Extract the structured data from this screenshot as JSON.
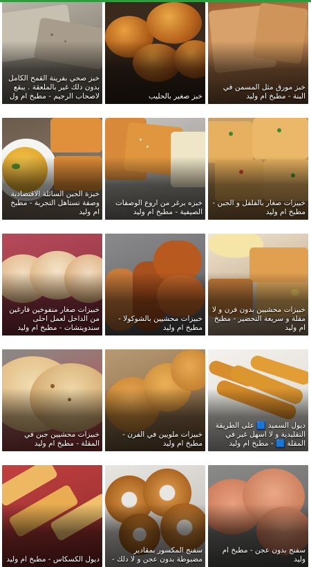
{
  "accent_color": "#2e9d3e",
  "recipes": [
    {
      "title": "خبز صحي بفرينة القمح الكامل بدون دلك غير بالملعقة . يبقع لاصحاب الرجيم - مطبخ ام ول"
    },
    {
      "title": "خبز صغير بالحليب"
    },
    {
      "title": "خبز مورق مثل المسمن في البنة - مطبخ ام وليد"
    },
    {
      "title": "خبزة الجبن السائلة الاقتصادية وصفة تستاهل التجربة - مطبخ ام وليد"
    },
    {
      "title": "خبزه برغر من اروع الوصفات الصيفية - مطبخ ام وليد"
    },
    {
      "title": "خبيزات صغار بالفلفل و الجبن - مطبخ ام وليد"
    },
    {
      "title": "خبيزات صغار منفوخين فارغين من الداخل لعمل احلى سندويتشات - مطبخ ام وليد"
    },
    {
      "title": "خبيزات محشيين بالشوكولا - مطبخ ام وليد"
    },
    {
      "title": "خبيزات محشيين بدون فرن و لا مقلة و سريعة التحضير - مطبخ ام وليد"
    },
    {
      "title": "خبيزات محشيين جبن في المقلة - مطبخ ام وليد"
    },
    {
      "title": "خبيزات ملويين في الفرن - مطبخ ام وليد"
    },
    {
      "title": "ديول السميد 🟦 على الطريقة التقليدية و لا اسهل غير في المقلة 🟦 - مطبخ ام وليد"
    },
    {
      "title": "ديول الكسكاس - مطبخ ام وليد"
    },
    {
      "title": "سفنج المكسور بمقادير مضبوطة بدون عجن و لا دلك -"
    },
    {
      "title": "سفنج بدون عجن - مطبخ ام وليد"
    }
  ]
}
